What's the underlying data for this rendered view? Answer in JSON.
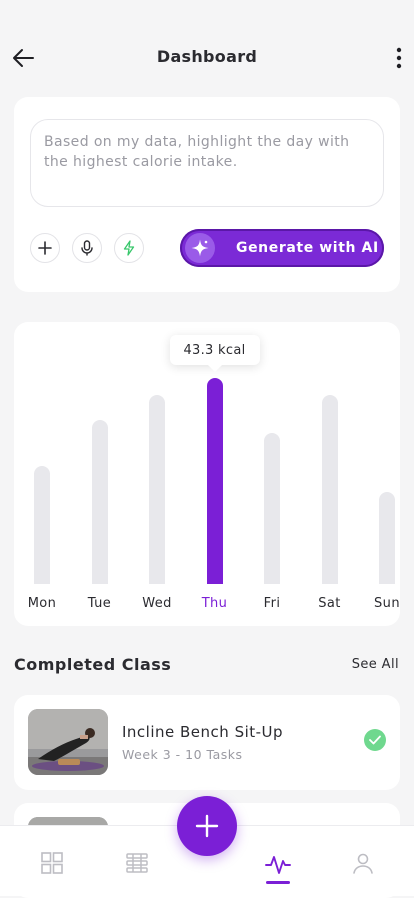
{
  "header": {
    "title": "Dashboard"
  },
  "prompt": {
    "placeholder": "Based on my data, highlight the day with the highest calorie intake.",
    "generate_label": "Generate with AI",
    "chips": [
      "plus-icon",
      "microphone-icon",
      "lightning-icon"
    ]
  },
  "chart_data": {
    "type": "bar",
    "categories": [
      "Mon",
      "Tue",
      "Wed",
      "Thu",
      "Fri",
      "Sat",
      "Sun"
    ],
    "values": [
      28,
      39,
      45,
      49,
      36,
      45,
      22
    ],
    "ylim": [
      0,
      50
    ],
    "highlight_index": 3,
    "tooltip": "43.3 kcal",
    "grid": false,
    "colors": {
      "bar": "#e8e8ec",
      "highlight": "#7b1fd6"
    }
  },
  "completed": {
    "title": "Completed Class",
    "see_all": "See All",
    "items": [
      {
        "name": "Incline Bench Sit-Up",
        "meta": "Week 3 - 10 Tasks",
        "done": true
      }
    ]
  },
  "nav": {
    "items": [
      "grid-icon",
      "dumbbell-icon",
      "add-icon",
      "activity-icon",
      "profile-icon"
    ],
    "active": "activity-icon"
  },
  "colors": {
    "accent": "#7b1fd6",
    "success": "#6fd88e",
    "background": "#f5f5f6"
  }
}
